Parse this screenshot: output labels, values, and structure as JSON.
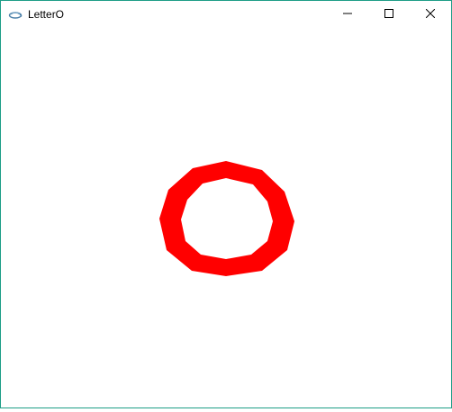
{
  "window": {
    "title": "LetterO",
    "accent_border": "#1e9e87"
  },
  "titlebar": {
    "app_icon": "java-cup-icon",
    "minimize_icon": "minimize-icon",
    "maximize_icon": "maximize-icon",
    "close_icon": "close-icon"
  },
  "canvas": {
    "background": "#ffffff",
    "shape": {
      "type": "decagon-ring",
      "fill": "#ff0000"
    }
  }
}
